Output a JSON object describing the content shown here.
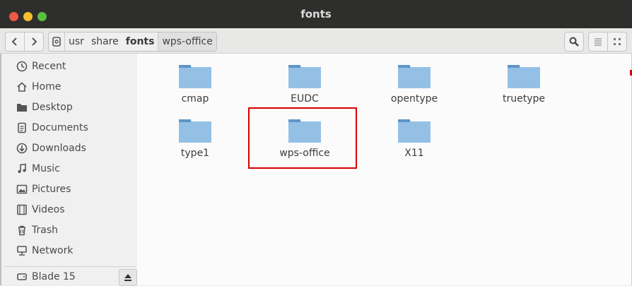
{
  "window": {
    "title": "fonts"
  },
  "toolbar": {
    "back_icon": "chevron-left-icon",
    "forward_icon": "chevron-right-icon",
    "breadcrumbs": [
      "usr",
      "share",
      "fonts",
      "wps-office"
    ],
    "current_crumb": "fonts"
  },
  "sidebar": {
    "items": [
      {
        "label": "Recent",
        "icon": "recent-icon"
      },
      {
        "label": "Home",
        "icon": "home-icon"
      },
      {
        "label": "Desktop",
        "icon": "desktop-folder-icon"
      },
      {
        "label": "Documents",
        "icon": "documents-icon"
      },
      {
        "label": "Downloads",
        "icon": "downloads-icon"
      },
      {
        "label": "Music",
        "icon": "music-icon"
      },
      {
        "label": "Pictures",
        "icon": "pictures-icon"
      },
      {
        "label": "Videos",
        "icon": "videos-icon"
      },
      {
        "label": "Trash",
        "icon": "trash-icon"
      },
      {
        "label": "Network",
        "icon": "network-icon"
      }
    ],
    "devices": [
      {
        "label": "Blade 15",
        "icon": "drive-icon"
      }
    ]
  },
  "files": [
    {
      "name": "cmap"
    },
    {
      "name": "EUDC"
    },
    {
      "name": "opentype"
    },
    {
      "name": "truetype"
    },
    {
      "name": "type1"
    },
    {
      "name": "wps-office"
    },
    {
      "name": "X11"
    }
  ],
  "colors": {
    "folder": "#94c0e6",
    "folder_tab": "#5f95c6",
    "highlight": "#d60000"
  }
}
